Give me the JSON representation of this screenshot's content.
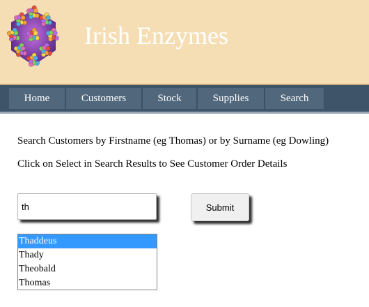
{
  "header": {
    "title": "Irish Enzymes",
    "logo_icon": "molecule-logo-icon"
  },
  "nav": {
    "items": [
      {
        "label": "Home"
      },
      {
        "label": "Customers"
      },
      {
        "label": "Stock"
      },
      {
        "label": "Supplies"
      },
      {
        "label": "Search"
      }
    ]
  },
  "main": {
    "instruction_1": "Search Customers by Firstname (eg Thomas) or by Surname (eg Dowling)",
    "instruction_2": "Click on Select in Search Results to See Customer Order Details",
    "search_value": "th",
    "submit_label": "Submit",
    "results": [
      {
        "name": "Thaddeus",
        "selected": true
      },
      {
        "name": "Thady",
        "selected": false
      },
      {
        "name": "Theobald",
        "selected": false
      },
      {
        "name": "Thomas",
        "selected": false
      }
    ]
  },
  "colors": {
    "header_bg": "#f5deb3",
    "nav_bg": "#3e5569",
    "nav_item_bg": "#50677c",
    "selection": "#3399ff"
  }
}
